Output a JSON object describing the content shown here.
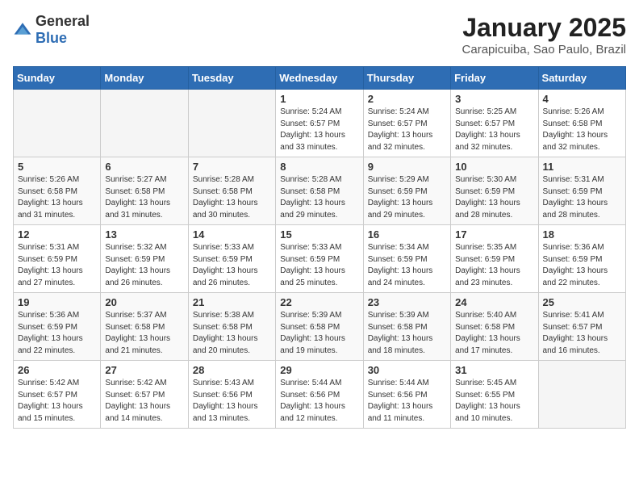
{
  "header": {
    "logo_general": "General",
    "logo_blue": "Blue",
    "title": "January 2025",
    "subtitle": "Carapicuiba, Sao Paulo, Brazil"
  },
  "weekdays": [
    "Sunday",
    "Monday",
    "Tuesday",
    "Wednesday",
    "Thursday",
    "Friday",
    "Saturday"
  ],
  "weeks": [
    [
      {
        "day": "",
        "info": ""
      },
      {
        "day": "",
        "info": ""
      },
      {
        "day": "",
        "info": ""
      },
      {
        "day": "1",
        "info": "Sunrise: 5:24 AM\nSunset: 6:57 PM\nDaylight: 13 hours\nand 33 minutes."
      },
      {
        "day": "2",
        "info": "Sunrise: 5:24 AM\nSunset: 6:57 PM\nDaylight: 13 hours\nand 32 minutes."
      },
      {
        "day": "3",
        "info": "Sunrise: 5:25 AM\nSunset: 6:57 PM\nDaylight: 13 hours\nand 32 minutes."
      },
      {
        "day": "4",
        "info": "Sunrise: 5:26 AM\nSunset: 6:58 PM\nDaylight: 13 hours\nand 32 minutes."
      }
    ],
    [
      {
        "day": "5",
        "info": "Sunrise: 5:26 AM\nSunset: 6:58 PM\nDaylight: 13 hours\nand 31 minutes."
      },
      {
        "day": "6",
        "info": "Sunrise: 5:27 AM\nSunset: 6:58 PM\nDaylight: 13 hours\nand 31 minutes."
      },
      {
        "day": "7",
        "info": "Sunrise: 5:28 AM\nSunset: 6:58 PM\nDaylight: 13 hours\nand 30 minutes."
      },
      {
        "day": "8",
        "info": "Sunrise: 5:28 AM\nSunset: 6:58 PM\nDaylight: 13 hours\nand 29 minutes."
      },
      {
        "day": "9",
        "info": "Sunrise: 5:29 AM\nSunset: 6:59 PM\nDaylight: 13 hours\nand 29 minutes."
      },
      {
        "day": "10",
        "info": "Sunrise: 5:30 AM\nSunset: 6:59 PM\nDaylight: 13 hours\nand 28 minutes."
      },
      {
        "day": "11",
        "info": "Sunrise: 5:31 AM\nSunset: 6:59 PM\nDaylight: 13 hours\nand 28 minutes."
      }
    ],
    [
      {
        "day": "12",
        "info": "Sunrise: 5:31 AM\nSunset: 6:59 PM\nDaylight: 13 hours\nand 27 minutes."
      },
      {
        "day": "13",
        "info": "Sunrise: 5:32 AM\nSunset: 6:59 PM\nDaylight: 13 hours\nand 26 minutes."
      },
      {
        "day": "14",
        "info": "Sunrise: 5:33 AM\nSunset: 6:59 PM\nDaylight: 13 hours\nand 26 minutes."
      },
      {
        "day": "15",
        "info": "Sunrise: 5:33 AM\nSunset: 6:59 PM\nDaylight: 13 hours\nand 25 minutes."
      },
      {
        "day": "16",
        "info": "Sunrise: 5:34 AM\nSunset: 6:59 PM\nDaylight: 13 hours\nand 24 minutes."
      },
      {
        "day": "17",
        "info": "Sunrise: 5:35 AM\nSunset: 6:59 PM\nDaylight: 13 hours\nand 23 minutes."
      },
      {
        "day": "18",
        "info": "Sunrise: 5:36 AM\nSunset: 6:59 PM\nDaylight: 13 hours\nand 22 minutes."
      }
    ],
    [
      {
        "day": "19",
        "info": "Sunrise: 5:36 AM\nSunset: 6:59 PM\nDaylight: 13 hours\nand 22 minutes."
      },
      {
        "day": "20",
        "info": "Sunrise: 5:37 AM\nSunset: 6:58 PM\nDaylight: 13 hours\nand 21 minutes."
      },
      {
        "day": "21",
        "info": "Sunrise: 5:38 AM\nSunset: 6:58 PM\nDaylight: 13 hours\nand 20 minutes."
      },
      {
        "day": "22",
        "info": "Sunrise: 5:39 AM\nSunset: 6:58 PM\nDaylight: 13 hours\nand 19 minutes."
      },
      {
        "day": "23",
        "info": "Sunrise: 5:39 AM\nSunset: 6:58 PM\nDaylight: 13 hours\nand 18 minutes."
      },
      {
        "day": "24",
        "info": "Sunrise: 5:40 AM\nSunset: 6:58 PM\nDaylight: 13 hours\nand 17 minutes."
      },
      {
        "day": "25",
        "info": "Sunrise: 5:41 AM\nSunset: 6:57 PM\nDaylight: 13 hours\nand 16 minutes."
      }
    ],
    [
      {
        "day": "26",
        "info": "Sunrise: 5:42 AM\nSunset: 6:57 PM\nDaylight: 13 hours\nand 15 minutes."
      },
      {
        "day": "27",
        "info": "Sunrise: 5:42 AM\nSunset: 6:57 PM\nDaylight: 13 hours\nand 14 minutes."
      },
      {
        "day": "28",
        "info": "Sunrise: 5:43 AM\nSunset: 6:56 PM\nDaylight: 13 hours\nand 13 minutes."
      },
      {
        "day": "29",
        "info": "Sunrise: 5:44 AM\nSunset: 6:56 PM\nDaylight: 13 hours\nand 12 minutes."
      },
      {
        "day": "30",
        "info": "Sunrise: 5:44 AM\nSunset: 6:56 PM\nDaylight: 13 hours\nand 11 minutes."
      },
      {
        "day": "31",
        "info": "Sunrise: 5:45 AM\nSunset: 6:55 PM\nDaylight: 13 hours\nand 10 minutes."
      },
      {
        "day": "",
        "info": ""
      }
    ]
  ]
}
